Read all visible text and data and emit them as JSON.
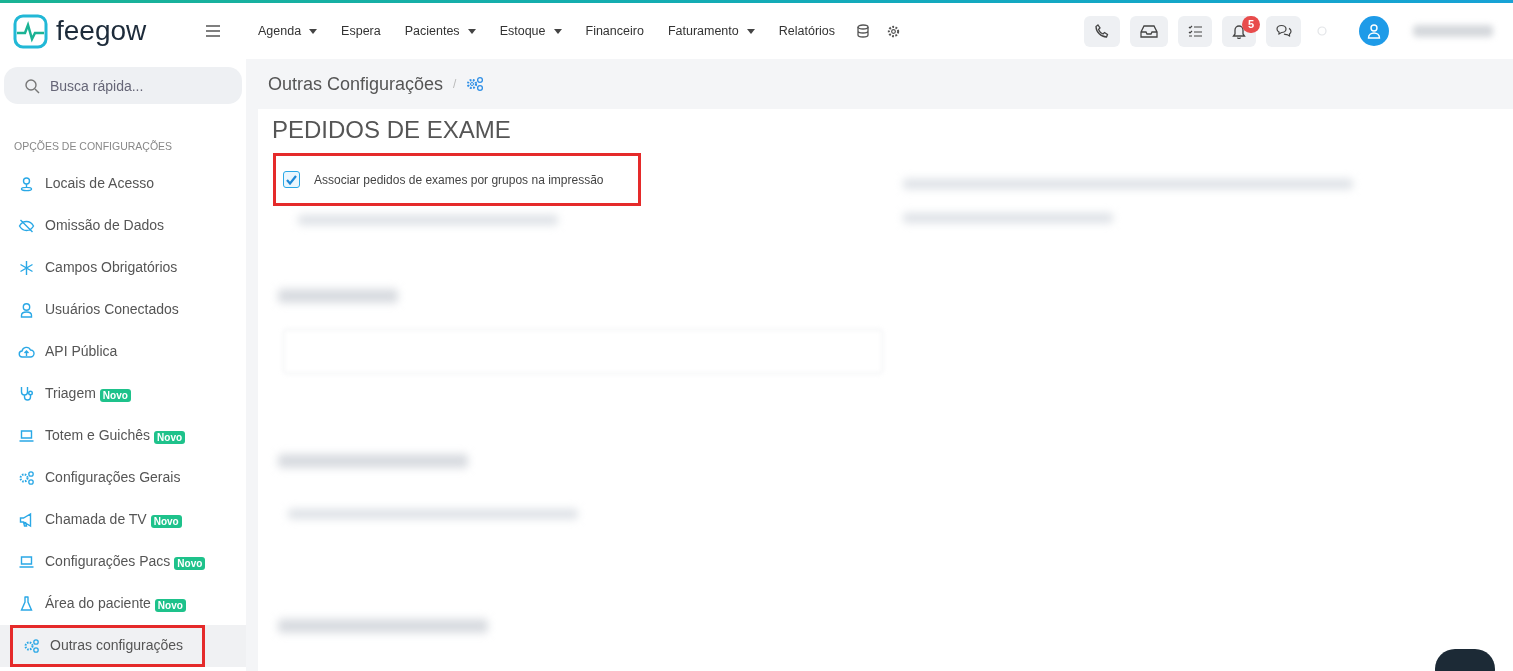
{
  "brand": {
    "name": "feegow"
  },
  "nav": [
    {
      "label": "Agenda",
      "dropdown": true
    },
    {
      "label": "Espera",
      "dropdown": false
    },
    {
      "label": "Pacientes",
      "dropdown": true
    },
    {
      "label": "Estoque",
      "dropdown": true
    },
    {
      "label": "Financeiro",
      "dropdown": false
    },
    {
      "label": "Faturamento",
      "dropdown": true
    },
    {
      "label": "Relatórios",
      "dropdown": false
    }
  ],
  "notifications": {
    "count": "5"
  },
  "search": {
    "placeholder": "Busca rápida..."
  },
  "breadcrumb": {
    "title": "Outras Configurações",
    "separator": "/"
  },
  "sidebar": {
    "heading": "OPÇÕES DE CONFIGURAÇÕES",
    "items": [
      {
        "label": "Locais de Acesso",
        "kind": "pin",
        "selected": false
      },
      {
        "label": "Omissão de Dados",
        "kind": "eyeoff",
        "selected": false
      },
      {
        "label": "Campos Obrigatórios",
        "kind": "asterisk",
        "selected": false
      },
      {
        "label": "Usuários Conectados",
        "kind": "user",
        "selected": false
      },
      {
        "label": "API Pública",
        "kind": "cloud",
        "selected": false
      },
      {
        "label": "Triagem",
        "kind": "stethoscope",
        "badge": "Novo",
        "selected": false
      },
      {
        "label": "Totem e Guichês",
        "kind": "laptop",
        "badge": "Novo",
        "selected": false
      },
      {
        "label": "Configurações Gerais",
        "kind": "gears",
        "selected": false
      },
      {
        "label": "Chamada de TV",
        "kind": "megaphone",
        "badge": "Novo",
        "selected": false
      },
      {
        "label": "Configurações Pacs",
        "kind": "laptop",
        "badge": "Novo",
        "selected": false
      },
      {
        "label": "Área do paciente",
        "kind": "flask",
        "badge": "Novo",
        "selected": false
      },
      {
        "label": "Outras configurações",
        "kind": "gears",
        "selected": true
      }
    ]
  },
  "section": {
    "title": "PEDIDOS DE EXAME",
    "options": [
      {
        "label": "Associar pedidos de exames por grupos na impressão",
        "checked": true
      }
    ]
  }
}
